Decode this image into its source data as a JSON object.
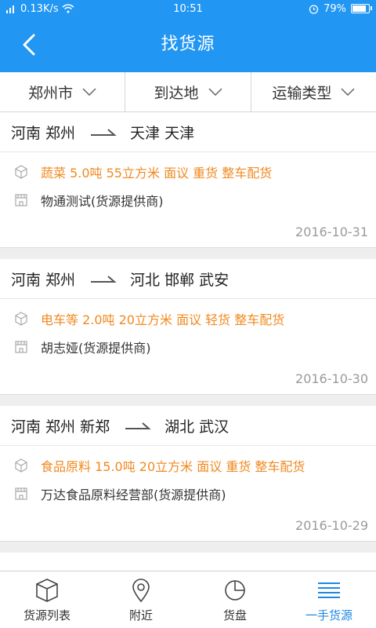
{
  "status_bar": {
    "signal": "0.13K/s",
    "time": "10:51",
    "battery": "79%",
    "battery_level": 0.79
  },
  "header": {
    "title": "找货源",
    "back_icon": "chevron-left-icon"
  },
  "filters": [
    {
      "label": "郑州市",
      "icon": "chevron-down-icon"
    },
    {
      "label": "到达地",
      "icon": "chevron-down-icon"
    },
    {
      "label": "运输类型",
      "icon": "chevron-down-icon"
    }
  ],
  "listings": [
    {
      "origin": "河南 郑州",
      "destination": "天津 天津",
      "goods": "蔬菜 5.0吨 55立方米 面议 重货 整车配货",
      "shipper": "物通测试(货源提供商)",
      "date": "2016-10-31"
    },
    {
      "origin": "河南 郑州",
      "destination": "河北 邯郸 武安",
      "goods": "电车等 2.0吨 20立方米 面议 轻货 整车配货",
      "shipper": "胡志娅(货源提供商)",
      "date": "2016-10-30"
    },
    {
      "origin": "河南 郑州 新郑",
      "destination": "湖北 武汉",
      "goods": "食品原料 15.0吨 20立方米 面议 重货 整车配货",
      "shipper": "万达食品原料经营部(货源提供商)",
      "date": "2016-10-29"
    }
  ],
  "tabs": [
    {
      "label": "货源列表",
      "icon": "box-icon",
      "active": false
    },
    {
      "label": "附近",
      "icon": "location-pin-icon",
      "active": false
    },
    {
      "label": "货盘",
      "icon": "pie-chart-icon",
      "active": false
    },
    {
      "label": "一手货源",
      "icon": "list-icon",
      "active": true
    }
  ],
  "colors": {
    "primary": "#2196f3",
    "accent_orange": "#f0891f",
    "date_gray": "#9a9a9a",
    "active_tab": "#1e88e5"
  }
}
